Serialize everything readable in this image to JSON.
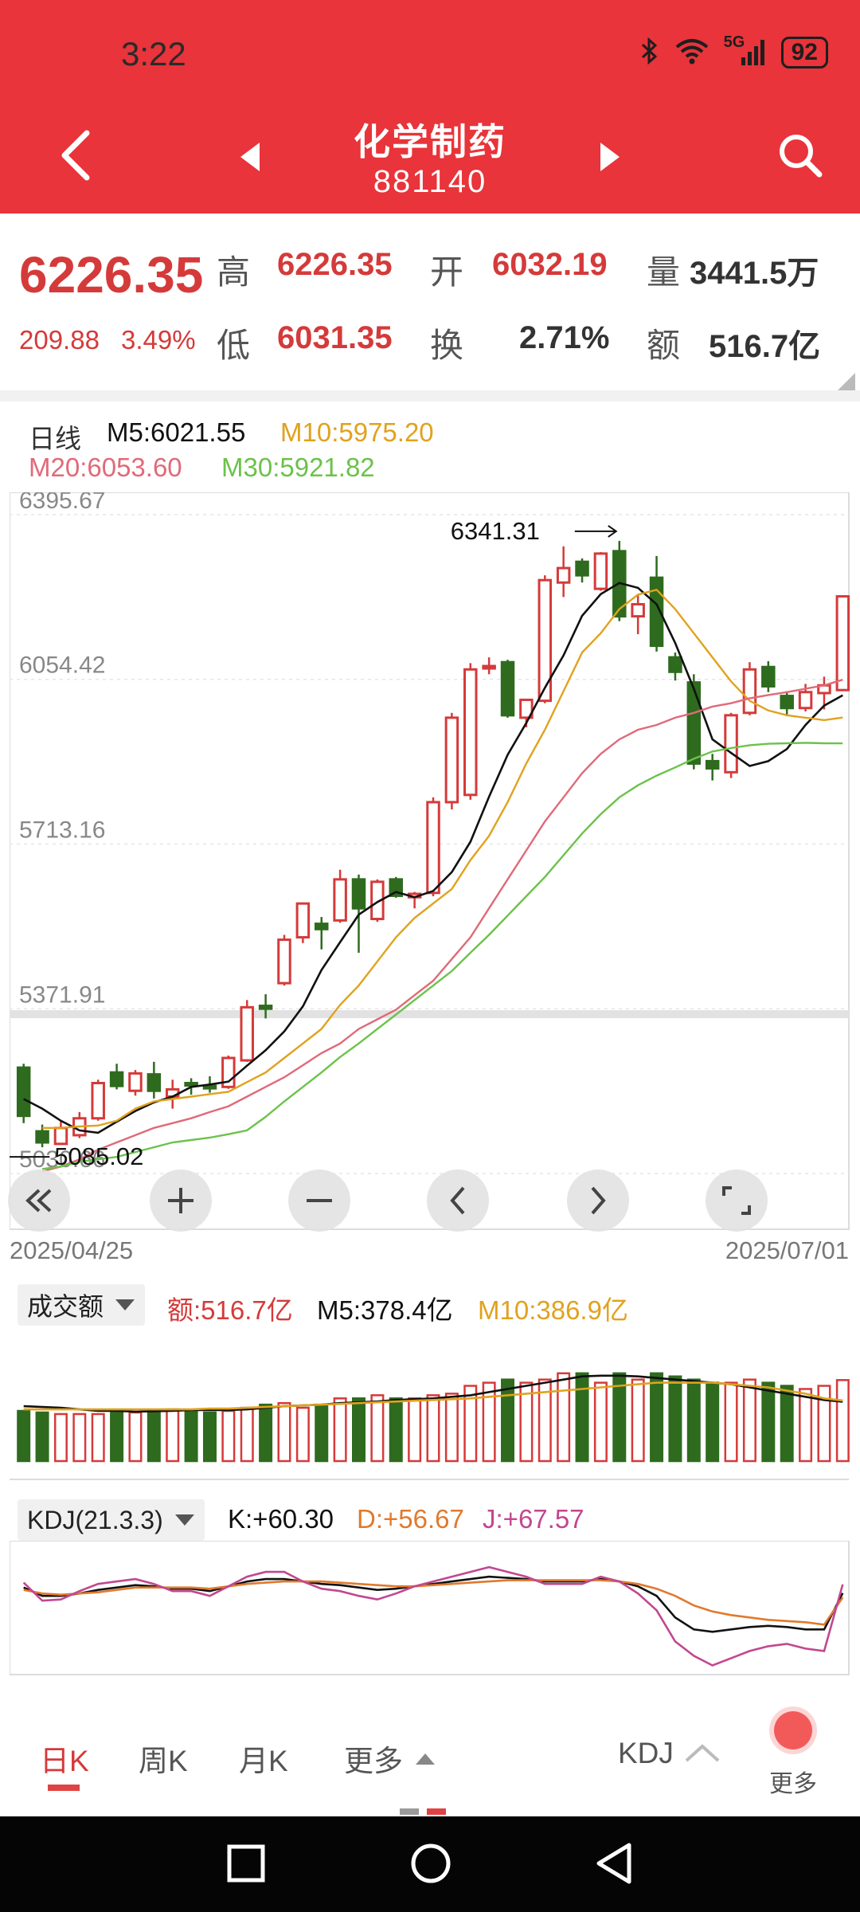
{
  "status_bar": {
    "time": "3:22",
    "signal": "5G",
    "battery": "92"
  },
  "header": {
    "title": "化学制药",
    "code": "881140"
  },
  "quote": {
    "price": "6226.35",
    "change": "209.88",
    "change_pct": "3.49%",
    "high_label": "高",
    "high": "6226.35",
    "low_label": "低",
    "low": "6031.35",
    "open_label": "开",
    "open": "6032.19",
    "turnover_label": "换",
    "turnover": "2.71%",
    "volume_label": "量",
    "volume": "3441.5万",
    "amount_label": "额",
    "amount": "516.7亿"
  },
  "ma_legend": {
    "period": "日线",
    "m5": "M5:6021.55",
    "m10": "M10:5975.20",
    "m20": "M20:6053.60",
    "m30": "M30:5921.82"
  },
  "colors": {
    "up": "#d53a3a",
    "down": "#2e6b1e",
    "m5": "#111111",
    "m10": "#e0a21e",
    "m20": "#e06a78",
    "m30": "#6cc24a",
    "accent": "#e8343a"
  },
  "main_chart": {
    "y_labels": [
      "6395.67",
      "6054.42",
      "5713.16",
      "5371.91",
      "5030.66"
    ],
    "max_annotation": "6341.31",
    "min_annotation": "5085.02",
    "date_start": "2025/04/25",
    "date_end": "2025/07/01"
  },
  "volume_panel": {
    "dropdown": "成交额",
    "amount": "额:516.7亿",
    "m5": "M5:378.4亿",
    "m10": "M10:386.9亿"
  },
  "kdj_panel": {
    "dropdown": "KDJ(21.3.3)",
    "k": "K:+60.30",
    "d": "D:+56.67",
    "j": "J:+67.57"
  },
  "bottom_tabs": {
    "day": "日K",
    "week": "周K",
    "month": "月K",
    "more": "更多",
    "indicator": "KDJ",
    "more_button": "更多"
  },
  "chart_data": {
    "type": "candlestick",
    "ylim": [
      5030.66,
      6395.67
    ],
    "y_ticks": [
      6395.67,
      6054.42,
      5713.16,
      5371.91,
      5030.66
    ],
    "x_range": [
      "2025/04/25",
      "2025/07/01"
    ],
    "max": 6341.31,
    "min": 5085.02,
    "candles": [
      {
        "o": 5250,
        "h": 5258,
        "l": 5135,
        "c": 5150
      },
      {
        "o": 5118,
        "h": 5132,
        "l": 5085,
        "c": 5095
      },
      {
        "o": 5092,
        "h": 5140,
        "l": 5090,
        "c": 5125
      },
      {
        "o": 5110,
        "h": 5158,
        "l": 5104,
        "c": 5145
      },
      {
        "o": 5145,
        "h": 5225,
        "l": 5140,
        "c": 5218
      },
      {
        "o": 5240,
        "h": 5258,
        "l": 5205,
        "c": 5212
      },
      {
        "o": 5202,
        "h": 5245,
        "l": 5192,
        "c": 5238
      },
      {
        "o": 5236,
        "h": 5262,
        "l": 5186,
        "c": 5202
      },
      {
        "o": 5190,
        "h": 5225,
        "l": 5165,
        "c": 5205
      },
      {
        "o": 5218,
        "h": 5228,
        "l": 5194,
        "c": 5215
      },
      {
        "o": 5212,
        "h": 5232,
        "l": 5198,
        "c": 5210
      },
      {
        "o": 5210,
        "h": 5275,
        "l": 5206,
        "c": 5270
      },
      {
        "o": 5265,
        "h": 5390,
        "l": 5262,
        "c": 5375
      },
      {
        "o": 5378,
        "h": 5402,
        "l": 5352,
        "c": 5372
      },
      {
        "o": 5425,
        "h": 5525,
        "l": 5420,
        "c": 5515
      },
      {
        "o": 5520,
        "h": 5592,
        "l": 5508,
        "c": 5590
      },
      {
        "o": 5548,
        "h": 5562,
        "l": 5495,
        "c": 5537
      },
      {
        "o": 5555,
        "h": 5660,
        "l": 5550,
        "c": 5640
      },
      {
        "o": 5640,
        "h": 5650,
        "l": 5488,
        "c": 5580
      },
      {
        "o": 5558,
        "h": 5640,
        "l": 5552,
        "c": 5635
      },
      {
        "o": 5640,
        "h": 5645,
        "l": 5602,
        "c": 5606
      },
      {
        "o": 5603,
        "h": 5614,
        "l": 5580,
        "c": 5610
      },
      {
        "o": 5612,
        "h": 5810,
        "l": 5605,
        "c": 5800
      },
      {
        "o": 5800,
        "h": 5985,
        "l": 5785,
        "c": 5975
      },
      {
        "o": 5815,
        "h": 6088,
        "l": 5805,
        "c": 6075
      },
      {
        "o": 6080,
        "h": 6100,
        "l": 6065,
        "c": 6082
      },
      {
        "o": 6090,
        "h": 6095,
        "l": 5975,
        "c": 5980
      },
      {
        "o": 5975,
        "h": 6005,
        "l": 5955,
        "c": 6012
      },
      {
        "o": 6010,
        "h": 6270,
        "l": 6005,
        "c": 6260
      },
      {
        "o": 6255,
        "h": 6330,
        "l": 6225,
        "c": 6285
      },
      {
        "o": 6298,
        "h": 6305,
        "l": 6255,
        "c": 6270
      },
      {
        "o": 6242,
        "h": 6318,
        "l": 6238,
        "c": 6315
      },
      {
        "o": 6320,
        "h": 6341.31,
        "l": 6175,
        "c": 6185
      },
      {
        "o": 6185,
        "h": 6230,
        "l": 6148,
        "c": 6210
      },
      {
        "o": 6265,
        "h": 6310,
        "l": 6112,
        "c": 6124
      },
      {
        "o": 6100,
        "h": 6110,
        "l": 6052,
        "c": 6070
      },
      {
        "o": 6048,
        "h": 6065,
        "l": 5868,
        "c": 5880
      },
      {
        "o": 5885,
        "h": 5900,
        "l": 5845,
        "c": 5870
      },
      {
        "o": 5862,
        "h": 5985,
        "l": 5850,
        "c": 5980
      },
      {
        "o": 5985,
        "h": 6090,
        "l": 5980,
        "c": 6075
      },
      {
        "o": 6080,
        "h": 6092,
        "l": 6028,
        "c": 6040
      },
      {
        "o": 6020,
        "h": 6030,
        "l": 5978,
        "c": 5995
      },
      {
        "o": 5995,
        "h": 6045,
        "l": 5988,
        "c": 6028
      },
      {
        "o": 6026,
        "h": 6060,
        "l": 5992,
        "c": 6042
      },
      {
        "o": 6032.19,
        "h": 6226.35,
        "l": 6031.35,
        "c": 6226.35
      }
    ],
    "series": [
      {
        "name": "M5",
        "values": [
          5185,
          5165,
          5140,
          5120,
          5115,
          5138,
          5160,
          5178,
          5190,
          5210,
          5215,
          5221,
          5254,
          5286,
          5325,
          5377,
          5452,
          5510,
          5567,
          5593,
          5614,
          5603,
          5616,
          5655,
          5718,
          5811,
          5898,
          5964,
          6037,
          6104,
          6186,
          6231,
          6254,
          6244,
          6210,
          6130,
          6035,
          5930,
          5902,
          5875,
          5885,
          5910,
          5960,
          6000,
          6021.55
        ]
      },
      {
        "name": "M10",
        "values": [
          null,
          5125,
          5125,
          5128,
          5130,
          5140,
          5165,
          5180,
          5185,
          5190,
          5195,
          5200,
          5220,
          5240,
          5270,
          5300,
          5330,
          5380,
          5420,
          5470,
          5520,
          5560,
          5590,
          5620,
          5680,
          5730,
          5800,
          5880,
          5950,
          6030,
          6110,
          6150,
          6200,
          6230,
          6240,
          6200,
          6150,
          6100,
          6050,
          6010,
          5990,
          5980,
          5975,
          5970,
          5975.2
        ]
      },
      {
        "name": "M20",
        "values": [
          null,
          5035,
          5045,
          5060,
          5080,
          5095,
          5110,
          5125,
          5135,
          5145,
          5158,
          5170,
          5190,
          5210,
          5230,
          5255,
          5280,
          5300,
          5330,
          5350,
          5370,
          5400,
          5430,
          5475,
          5520,
          5580,
          5640,
          5700,
          5760,
          5810,
          5860,
          5900,
          5930,
          5950,
          5960,
          5975,
          5985,
          5998,
          6005,
          6015,
          6022,
          6028,
          6035,
          6042,
          6053.6
        ]
      },
      {
        "name": "M30",
        "values": [
          null,
          5040,
          5045,
          5055,
          5060,
          5065,
          5075,
          5085,
          5095,
          5100,
          5105,
          5112,
          5120,
          5148,
          5180,
          5210,
          5240,
          5272,
          5300,
          5330,
          5360,
          5390,
          5420,
          5450,
          5488,
          5525,
          5565,
          5605,
          5645,
          5690,
          5735,
          5775,
          5810,
          5835,
          5855,
          5872,
          5890,
          5905,
          5912,
          5918,
          5921,
          5922,
          5923,
          5922,
          5921.82
        ]
      }
    ],
    "volume": {
      "values": [
        320,
        310,
        300,
        300,
        300,
        320,
        310,
        320,
        330,
        320,
        310,
        320,
        340,
        360,
        370,
        340,
        360,
        400,
        400,
        420,
        400,
        400,
        420,
        430,
        480,
        500,
        520,
        500,
        520,
        560,
        560,
        500,
        560,
        520,
        560,
        540,
        520,
        500,
        500,
        520,
        500,
        480,
        460,
        480,
        516.7
      ],
      "ma5": [
        350,
        345,
        340,
        330,
        320,
        320,
        315,
        318,
        320,
        325,
        325,
        325,
        330,
        340,
        350,
        355,
        360,
        370,
        375,
        380,
        390,
        395,
        400,
        410,
        420,
        440,
        460,
        480,
        500,
        520,
        540,
        545,
        545,
        540,
        530,
        520,
        510,
        500,
        490,
        470,
        450,
        430,
        410,
        390,
        378.4
      ],
      "ma10": [
        330,
        330,
        330,
        330,
        330,
        330,
        330,
        330,
        330,
        330,
        335,
        335,
        340,
        345,
        350,
        355,
        360,
        365,
        370,
        375,
        380,
        385,
        390,
        395,
        400,
        410,
        420,
        430,
        440,
        450,
        460,
        470,
        480,
        490,
        500,
        500,
        500,
        500,
        490,
        480,
        470,
        450,
        430,
        400,
        386.9
      ]
    },
    "kdj": {
      "K": [
        65,
        58,
        58,
        60,
        63,
        65,
        67,
        66,
        64,
        64,
        62,
        66,
        70,
        72,
        72,
        70,
        68,
        67,
        65,
        63,
        64,
        66,
        68,
        70,
        72,
        74,
        73,
        72,
        70,
        70,
        70,
        72,
        70,
        66,
        58,
        40,
        30,
        28,
        30,
        32,
        33,
        32,
        30,
        30,
        60.3
      ],
      "D": [
        63,
        60,
        59,
        60,
        61,
        63,
        65,
        65,
        65,
        65,
        64,
        66,
        68,
        69,
        70,
        70,
        70,
        69,
        68,
        67,
        66,
        66,
        67,
        68,
        69,
        70,
        71,
        71,
        71,
        71,
        71,
        71,
        70,
        68,
        64,
        58,
        50,
        45,
        42,
        40,
        38,
        37,
        36,
        34,
        56.67
      ],
      "J": [
        69,
        54,
        55,
        62,
        68,
        70,
        72,
        68,
        62,
        62,
        58,
        66,
        74,
        78,
        78,
        70,
        64,
        62,
        58,
        55,
        60,
        66,
        70,
        74,
        78,
        82,
        78,
        74,
        68,
        68,
        68,
        74,
        70,
        60,
        46,
        20,
        8,
        0,
        6,
        12,
        16,
        18,
        14,
        12,
        67.57
      ]
    }
  }
}
